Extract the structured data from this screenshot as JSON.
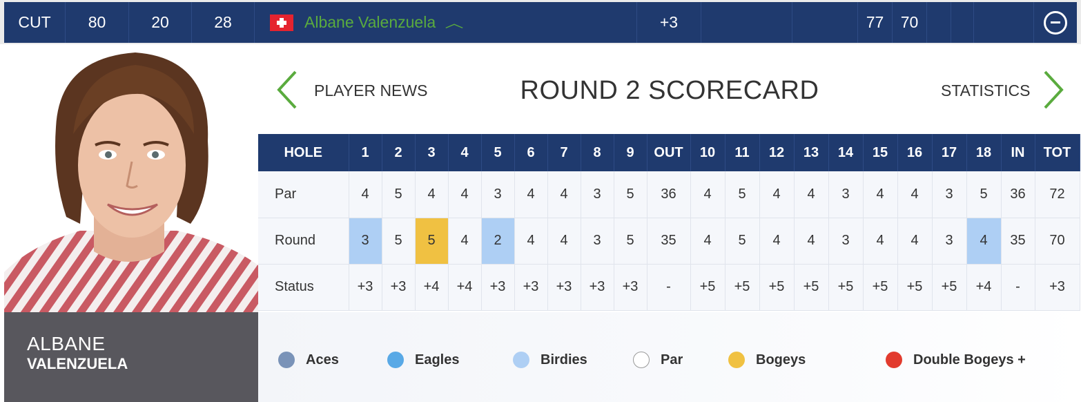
{
  "leaderboard_row": {
    "pos": "CUT",
    "col2": "80",
    "col3": "20",
    "col4": "28",
    "player": "Albane Valenzuela",
    "to_par": "+3",
    "r1": "77",
    "r2": "70"
  },
  "player": {
    "first_name": "ALBANE",
    "last_name": "VALENZUELA"
  },
  "nav": {
    "prev_label": "PLAYER NEWS",
    "title": "ROUND 2 SCORECARD",
    "next_label": "STATISTICS"
  },
  "scorecard": {
    "headers": [
      "HOLE",
      "1",
      "2",
      "3",
      "4",
      "5",
      "6",
      "7",
      "8",
      "9",
      "OUT",
      "10",
      "11",
      "12",
      "13",
      "14",
      "15",
      "16",
      "17",
      "18",
      "IN",
      "TOT"
    ],
    "rows": [
      {
        "label": "Par",
        "cells": [
          "4",
          "5",
          "4",
          "4",
          "3",
          "4",
          "4",
          "3",
          "5",
          "36",
          "4",
          "5",
          "4",
          "4",
          "3",
          "4",
          "4",
          "3",
          "5",
          "36",
          "72"
        ]
      },
      {
        "label": "Round",
        "cells": [
          "3",
          "5",
          "5",
          "4",
          "2",
          "4",
          "4",
          "3",
          "5",
          "35",
          "4",
          "5",
          "4",
          "4",
          "3",
          "4",
          "4",
          "3",
          "4",
          "35",
          "70"
        ]
      },
      {
        "label": "Status",
        "cells": [
          "+3",
          "+3",
          "+4",
          "+4",
          "+3",
          "+3",
          "+3",
          "+3",
          "+3",
          "-",
          "+5",
          "+5",
          "+5",
          "+5",
          "+5",
          "+5",
          "+5",
          "+5",
          "+4",
          "-",
          "+3"
        ]
      }
    ],
    "round_highlights": [
      "birdie",
      "",
      "bogey",
      "",
      "birdie",
      "",
      "",
      "",
      "",
      "",
      "",
      "",
      "",
      "",
      "",
      "",
      "",
      "",
      "birdie",
      "",
      ""
    ]
  },
  "legend": [
    {
      "label": "Aces",
      "color": "#7a93b8"
    },
    {
      "label": "Eagles",
      "color": "#59a9e6"
    },
    {
      "label": "Birdies",
      "color": "#aecff4"
    },
    {
      "label": "Par",
      "color": "#ffffff"
    },
    {
      "label": "Bogeys",
      "color": "#f0c142"
    },
    {
      "label": "Double Bogeys +",
      "color": "#e23b2e"
    }
  ],
  "colors": {
    "navy": "#1f3a6e",
    "accent_green": "#5aab3e",
    "name_panel": "#58575d"
  },
  "icons": {
    "flag": "swiss-flag-icon",
    "expand": "chevron-up-icon",
    "collapse": "minus-circle-icon",
    "prev": "chevron-left-icon",
    "next": "chevron-right-icon"
  }
}
